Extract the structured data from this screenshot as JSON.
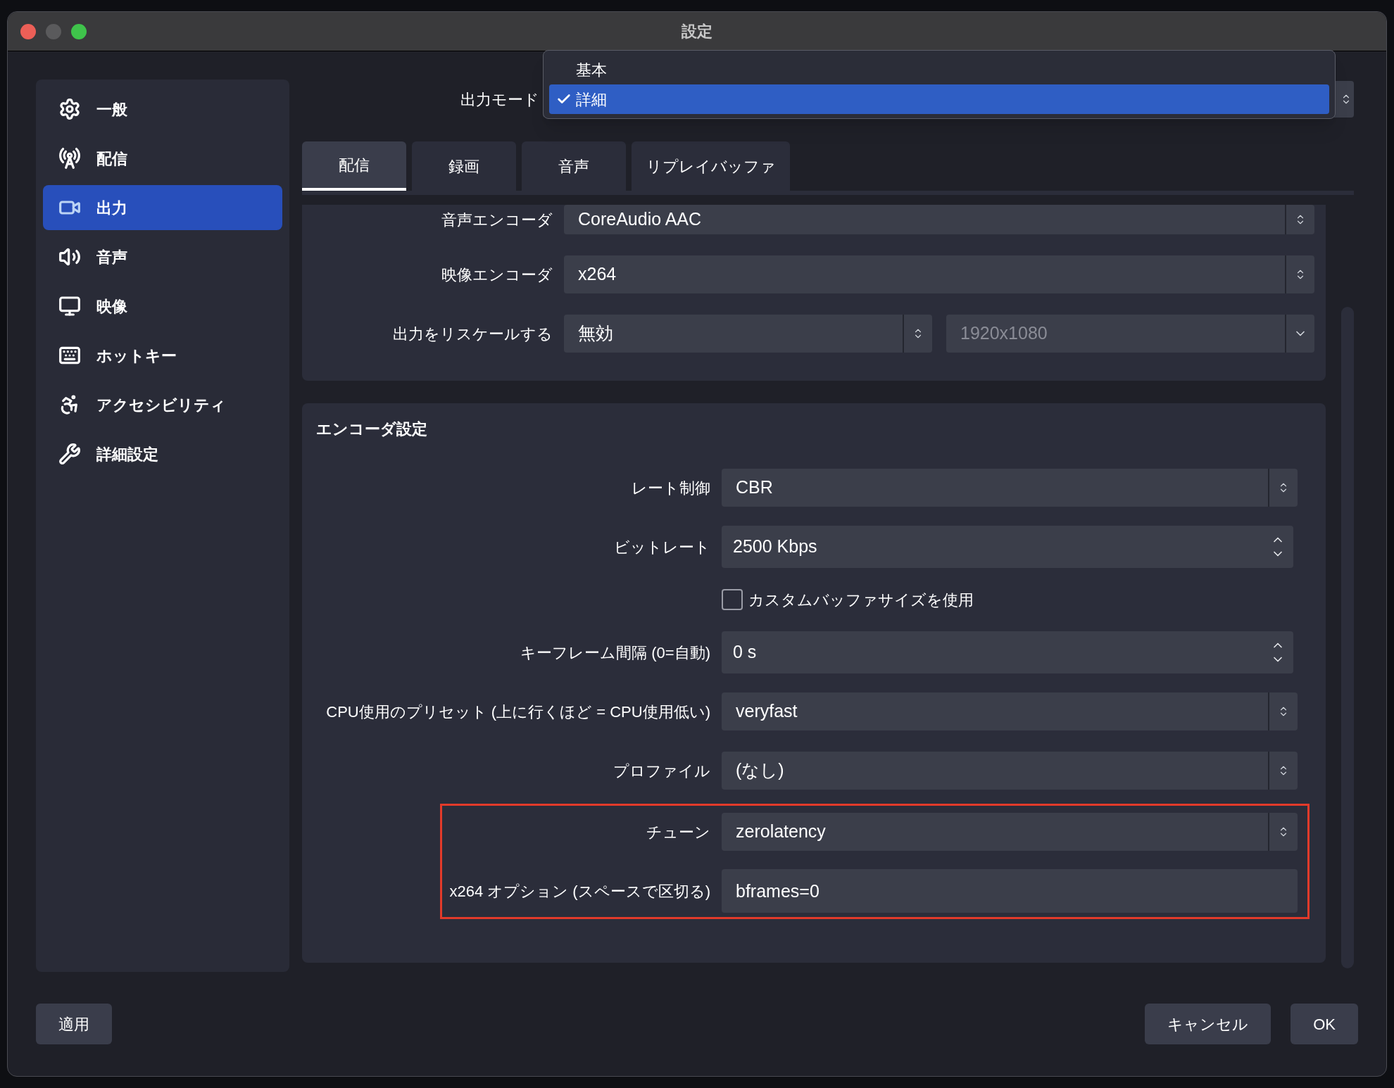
{
  "window": {
    "title": "設定"
  },
  "sidebar": {
    "items": [
      {
        "label": "一般",
        "selected": false
      },
      {
        "label": "配信",
        "selected": false
      },
      {
        "label": "出力",
        "selected": true
      },
      {
        "label": "音声",
        "selected": false
      },
      {
        "label": "映像",
        "selected": false
      },
      {
        "label": "ホットキー",
        "selected": false
      },
      {
        "label": "アクセシビリティ",
        "selected": false
      },
      {
        "label": "詳細設定",
        "selected": false
      }
    ]
  },
  "output_mode": {
    "label": "出力モード",
    "options": [
      {
        "label": "基本",
        "selected": false
      },
      {
        "label": "詳細",
        "selected": true
      }
    ]
  },
  "tabs": [
    {
      "label": "配信",
      "selected": true
    },
    {
      "label": "録画",
      "selected": false
    },
    {
      "label": "音声",
      "selected": false
    },
    {
      "label": "リプレイバッファ",
      "selected": false
    }
  ],
  "stream_section": {
    "rows": [
      {
        "label": "音声エンコーダ",
        "value": "CoreAudio AAC"
      },
      {
        "label": "映像エンコーダ",
        "value": "x264"
      },
      {
        "label": "出力をリスケールする",
        "value": "無効",
        "resolution": "1920x1080"
      }
    ]
  },
  "encoder_section": {
    "title": "エンコーダ設定",
    "rows": [
      {
        "kind": "select",
        "label": "レート制御",
        "value": "CBR",
        "highlighted": false
      },
      {
        "kind": "spin",
        "label": "ビットレート",
        "value": "2500 Kbps",
        "highlighted": false
      },
      {
        "kind": "checkbox",
        "label": "カスタムバッファサイズを使用",
        "checked": false,
        "highlighted": false
      },
      {
        "kind": "spin",
        "label": "キーフレーム間隔 (0=自動)",
        "value": "0 s",
        "highlighted": false
      },
      {
        "kind": "select",
        "label": "CPU使用のプリセット (上に行くほど = CPU使用低い)",
        "value": "veryfast",
        "highlighted": false
      },
      {
        "kind": "select",
        "label": "プロファイル",
        "value": "(なし)",
        "highlighted": false
      },
      {
        "kind": "select",
        "label": "チューン",
        "value": "zerolatency",
        "highlighted": true
      },
      {
        "kind": "text",
        "label": "x264 オプション (スペースで区切る)",
        "value": "bframes=0",
        "highlighted": true
      }
    ]
  },
  "buttons": {
    "apply": "適用",
    "cancel": "キャンセル",
    "ok": "OK"
  }
}
